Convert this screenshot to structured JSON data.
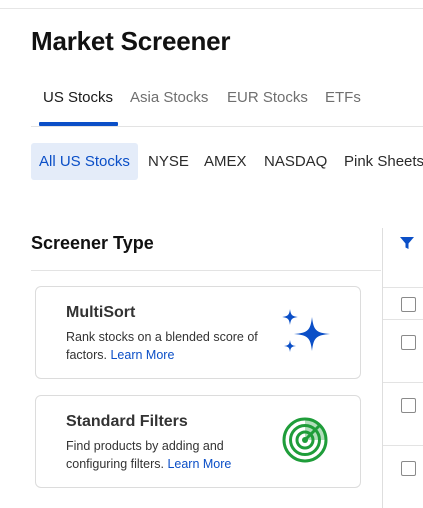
{
  "header": {
    "title": "Market Screener"
  },
  "tabs": [
    {
      "label": "US Stocks",
      "active": true
    },
    {
      "label": "Asia Stocks",
      "active": false
    },
    {
      "label": "EUR Stocks",
      "active": false
    },
    {
      "label": "ETFs",
      "active": false
    }
  ],
  "exchanges": [
    {
      "label": "All US Stocks",
      "active": true
    },
    {
      "label": "NYSE",
      "active": false
    },
    {
      "label": "AMEX",
      "active": false
    },
    {
      "label": "NASDAQ",
      "active": false
    },
    {
      "label": "Pink Sheets",
      "active": false
    }
  ],
  "screener": {
    "title": "Screener Type",
    "cards": [
      {
        "title": "MultiSort",
        "desc": "Rank stocks on a blended score of factors.",
        "link": "Learn More",
        "icon": "sparkles-icon"
      },
      {
        "title": "Standard Filters",
        "desc": "Find products by adding and configuring filters.",
        "link": "Learn More",
        "icon": "radar-icon"
      }
    ]
  },
  "results_panel": {
    "filter_icon": "filter-icon",
    "checkbox_count": 4
  },
  "colors": {
    "accent": "#0b4fc7",
    "active_bg": "#e4ecf9",
    "radar_green": "#1f9d3a"
  }
}
